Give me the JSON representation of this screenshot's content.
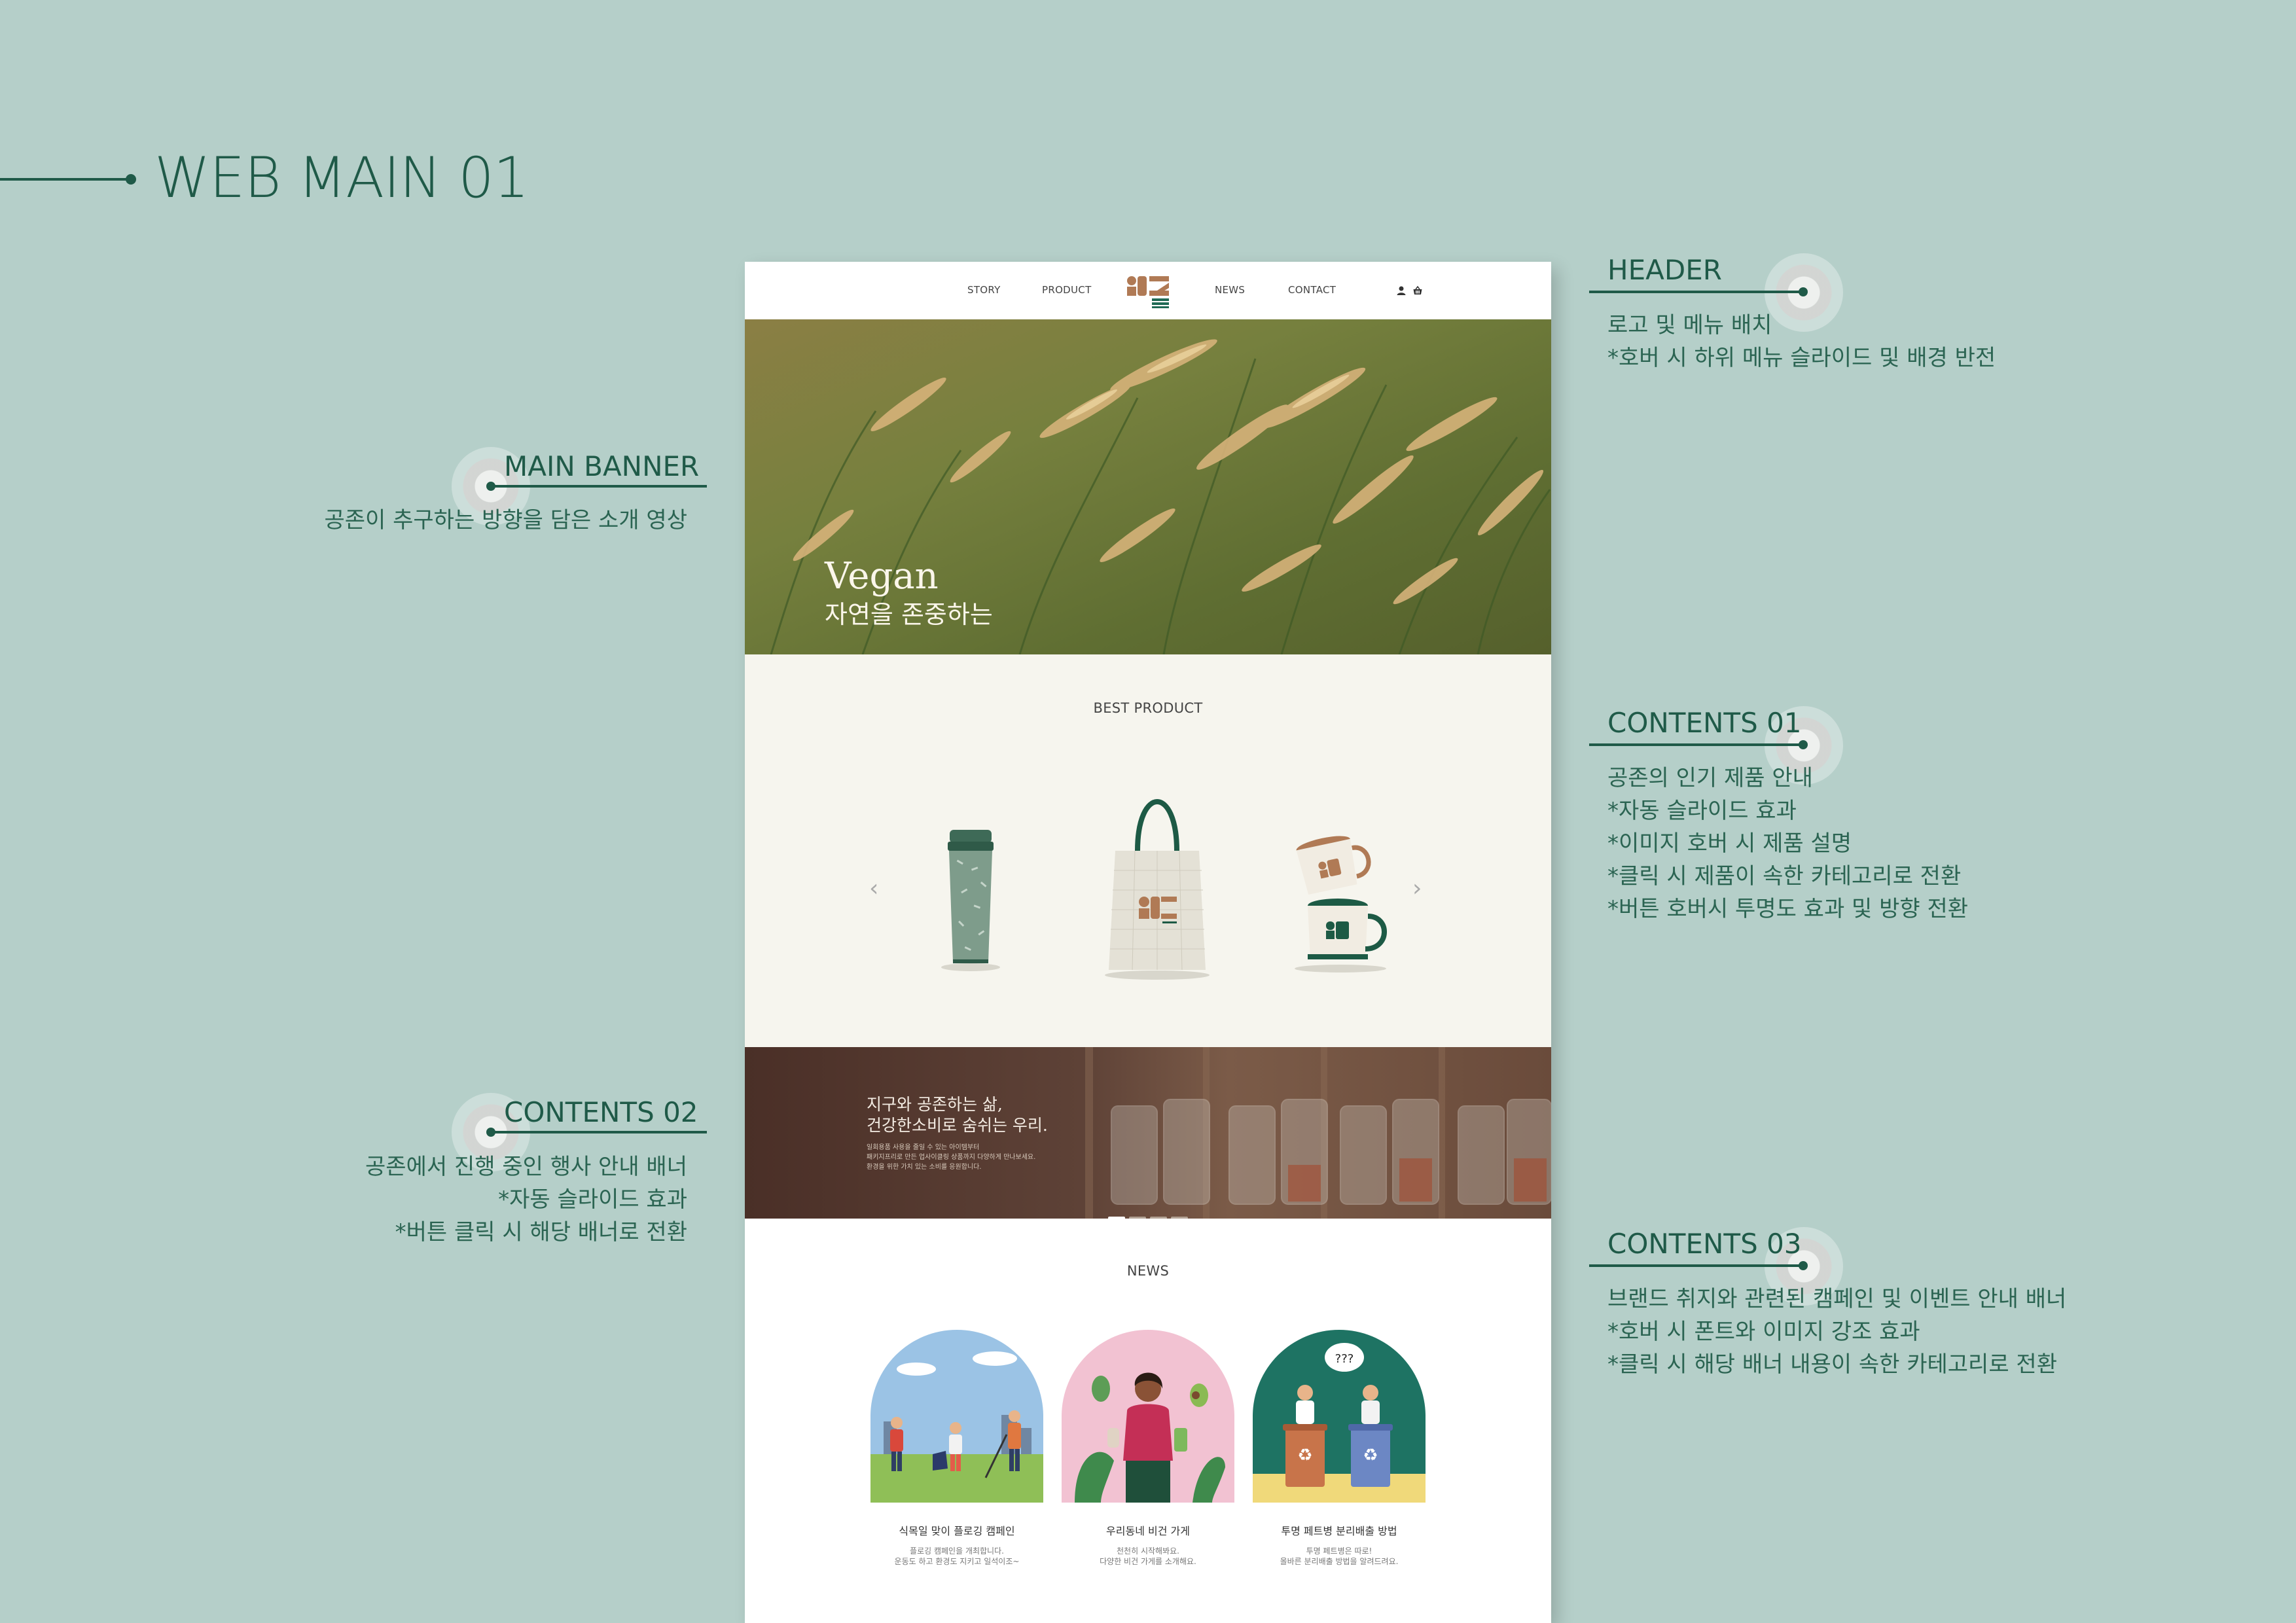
{
  "page": {
    "title": "WEB MAIN 01"
  },
  "annotations": {
    "header": {
      "title": "HEADER",
      "lines": [
        "로고 및 메뉴 배치",
        "*호버 시 하위 메뉴 슬라이드 및 배경 반전"
      ]
    },
    "main_banner": {
      "title": "MAIN BANNER",
      "lines": [
        "공존이 추구하는 방향을 담은 소개 영상"
      ]
    },
    "contents01": {
      "title": "CONTENTS 01",
      "lines": [
        "공존의 인기 제품 안내",
        "*자동 슬라이드 효과",
        "*이미지 호버 시 제품 설명",
        "*클릭 시 제품이 속한 카테고리로 전환",
        "*버튼 호버시 투명도 효과 및 방향 전환"
      ]
    },
    "contents02": {
      "title": "CONTENTS 02",
      "lines": [
        "공존에서 진행 중인 행사 안내 배너",
        "*자동 슬라이드 효과",
        "*버튼 클릭 시 해당 배너로 전환"
      ]
    },
    "contents03": {
      "title": "CONTENTS 03",
      "lines": [
        "브랜드 취지와 관련된 캠페인 및 이벤트 안내 배너",
        "*호버 시 폰트와 이미지 강조 효과",
        "*클릭 시 해당 배너 내용이 속한 카테고리로 전환"
      ]
    }
  },
  "mockup": {
    "nav": {
      "story": "STORY",
      "product": "PRODUCT",
      "news": "NEWS",
      "contact": "CONTACT"
    },
    "icons": [
      "user-icon",
      "basket-icon"
    ],
    "banner": {
      "title": "Vegan",
      "subtitle": "자연을 존중하는"
    },
    "best": {
      "heading": "BEST PRODUCT",
      "products": [
        "tumbler",
        "tote-bag",
        "enamel-mugs"
      ]
    },
    "event": {
      "title_lines": [
        "지구와 공존하는 삶,",
        "건강한소비로 숨쉬는 우리."
      ],
      "small_lines": [
        "일회용품 사용을 줄일 수 있는 아이템부터",
        "패키지프리로 만든 업사이클링 상품까지 다양하게 만나보세요.",
        "환경을 위한 가치 있는 소비를 응원합니다."
      ],
      "slides": 4,
      "active_slide": 1
    },
    "news": {
      "heading": "NEWS",
      "items": [
        {
          "title": "식목일 맞이 플로깅 캠페인",
          "desc": [
            "플로깅 캠페인을 개최합니다.",
            "운동도 하고 환경도 지키고 일석이조~"
          ]
        },
        {
          "title": "우리동네 비건 가게",
          "desc": [
            "천천히 시작해봐요.",
            "다양한 비건 가게를 소개해요."
          ]
        },
        {
          "title": "투명 페트병 분리배출 방법",
          "desc": [
            "투명 페트병은 따로!",
            "올바른 분리배출 방법을 알려드려요."
          ]
        }
      ]
    }
  },
  "colors": {
    "background": "#b5cfc9",
    "accent": "#1f5a48",
    "logo": "#b07a55",
    "cream": "#f6f5ee"
  }
}
